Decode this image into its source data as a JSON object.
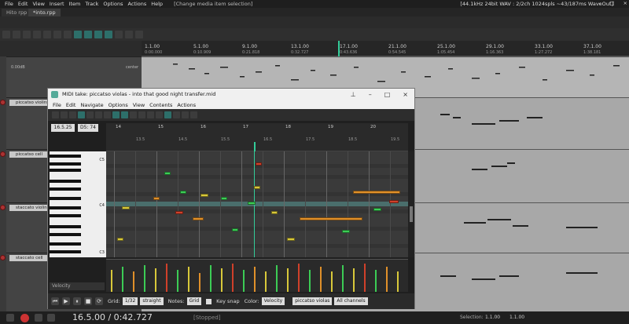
{
  "menubar": {
    "items": [
      "File",
      "Edit",
      "View",
      "Insert",
      "Item",
      "Track",
      "Options",
      "Actions",
      "Help"
    ],
    "hint": "[Change media item selection]",
    "right_info": "[44.1kHz 24bit WAV : 2/2ch 1024spls ~43/187ms WaveOut]"
  },
  "tabs": [
    {
      "label": "Hito rpp"
    },
    {
      "label": "*into.rpp"
    }
  ],
  "ruler": {
    "marks": [
      "1.1.00",
      "5.1.00",
      "9.1.00",
      "13.1.00",
      "17.1.00",
      "21.1.00",
      "25.1.00",
      "29.1.00",
      "33.1.00",
      "37.1.00"
    ],
    "subs": [
      "0:00.000",
      "0:10.909",
      "0:21.818",
      "0:32.727",
      "0:43.636",
      "0:54.545",
      "1:05.454",
      "1:16.363",
      "1:27.272",
      "1:38.181"
    ]
  },
  "tracks": [
    {
      "name": "piccatso violins"
    },
    {
      "name": "piccatso cell"
    },
    {
      "name": "staccato violins"
    },
    {
      "name": "staccato cell"
    }
  ],
  "track_misc": {
    "db": "0.00dB",
    "pan": "center"
  },
  "midi_editor": {
    "title": "MIDI take: piccatso violas - into that good night transfer.mid",
    "menu": [
      "File",
      "Edit",
      "Navigate",
      "Options",
      "View",
      "Contents",
      "Actions"
    ],
    "position": "16.5.25",
    "note": "D5: 74",
    "ruler_bars": [
      "14",
      "15",
      "16",
      "17",
      "18",
      "19",
      "20"
    ],
    "ruler_subs": [
      "13.5",
      "14.5",
      "15.5",
      "16.5",
      "17.5",
      "18.5",
      "19.5"
    ],
    "octave_labels": [
      "C5",
      "C4",
      "C3"
    ],
    "velocity_label": "Velocity",
    "bottom": {
      "grid_label": "Grid:",
      "grid_value": "1/32",
      "swing_value": "straight",
      "notes_label": "Notes:",
      "notes_value": "Grid",
      "keysnap_label": "Key snap",
      "color_label": "Color:",
      "color_value": "Velocity",
      "take_value": "piccatso violas",
      "channel_value": "All channels"
    }
  },
  "transport": {
    "time": "16.5.00 / 0:42.727",
    "status": "[Stopped]",
    "selection_label": "Selection:",
    "selection_start": "1.1.00",
    "selection_end": "1.1.00"
  },
  "colors": {
    "accent": "#2d6f6a",
    "note_green": "#3ccc55",
    "note_yellow": "#d8c83a",
    "note_orange": "#e0902a",
    "note_red": "#d0402a"
  }
}
